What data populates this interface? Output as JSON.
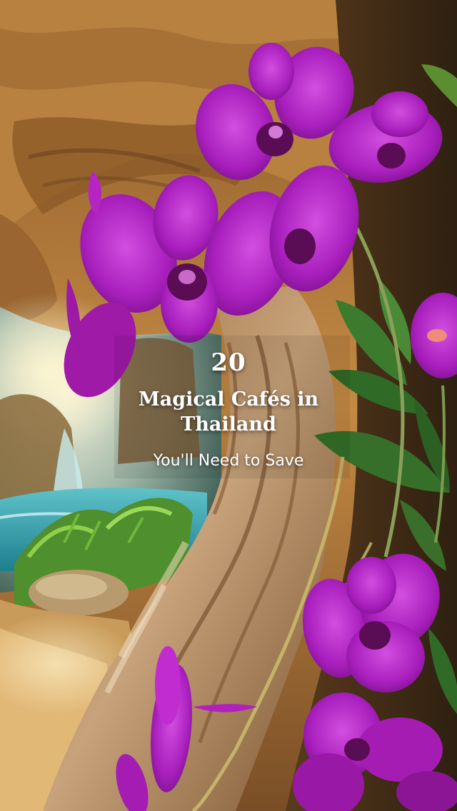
{
  "overlay": {
    "number": "20",
    "title_line1": "Magical Cafés in",
    "title_line2": "Thailand",
    "subtitle": "You'll Need to Save"
  },
  "colors": {
    "orchid": "#b020c8",
    "orchid_dark": "#6e0a6a",
    "rock": "#b07a3e",
    "waterfall": "#2aa6b8",
    "leaf": "#3c7a2e",
    "text": "#ffffff"
  }
}
